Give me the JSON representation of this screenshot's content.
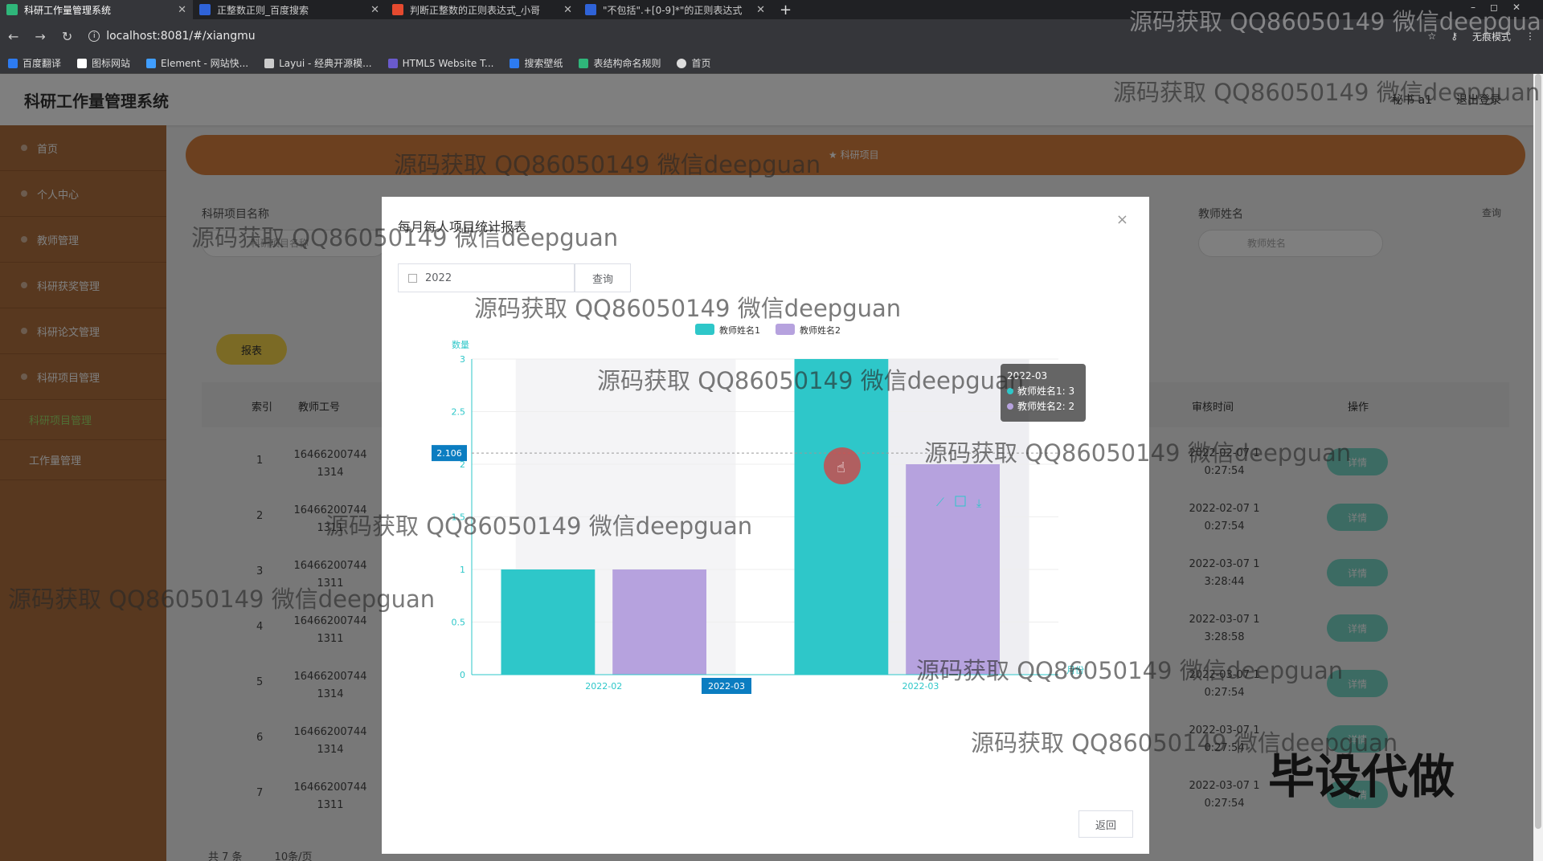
{
  "browser": {
    "tabs": [
      {
        "title": "科研工作量管理系统",
        "color": "#2fb67a",
        "active": true
      },
      {
        "title": "正整数正则_百度搜索",
        "color": "#2f63d8",
        "active": false
      },
      {
        "title": "判断正整数的正则表达式_小哥",
        "color": "#e54a2f",
        "active": false
      },
      {
        "title": "\"不包括\".+[0-9]*\"的正则表达式",
        "color": "#2f63d8",
        "active": false
      }
    ],
    "new_tab": "+",
    "url": "localhost:8081/#/xiangmu",
    "incognito_label": "无痕模式",
    "bookmarks": [
      {
        "label": "百度翻译",
        "color": "#2d7bf0"
      },
      {
        "label": "图标网站",
        "color": "#fff"
      },
      {
        "label": "Element - 网站快...",
        "color": "#409eff"
      },
      {
        "label": "Layui - 经典开源模...",
        "color": "#ccc"
      },
      {
        "label": "HTML5 Website T...",
        "color": "#6a5acd"
      },
      {
        "label": "搜索壁纸",
        "color": "#2d7bf0"
      },
      {
        "label": "表结构命名规则",
        "color": "#2fb67a"
      },
      {
        "label": "首页",
        "color": "#ddd"
      }
    ]
  },
  "app": {
    "title": "科研工作量管理系统",
    "user": "秘书 a1",
    "logout": "退出登录"
  },
  "sidebar": {
    "items": [
      {
        "label": "首页"
      },
      {
        "label": "个人中心"
      },
      {
        "label": "教师管理"
      },
      {
        "label": "科研获奖管理"
      },
      {
        "label": "科研论文管理"
      },
      {
        "label": "科研项目管理"
      },
      {
        "label": "科研项目管理"
      },
      {
        "label": "工作量管理"
      }
    ]
  },
  "main": {
    "banner_star": "★",
    "banner_text": "科研项目",
    "search_label_left": "科研项目名称",
    "search_placeholder_left": "科研项目名称",
    "search_label_right": "教师姓名",
    "search_placeholder_right": "教师姓名",
    "search_btn": "查询",
    "report_btn": "报表",
    "columns": [
      "索引",
      "教师工号",
      "审核时间",
      "操作"
    ],
    "rows": [
      {
        "idx": "1",
        "emp": "16466200744 1314",
        "time": "2022-02-07 1 0:27:54"
      },
      {
        "idx": "2",
        "emp": "16466200744 1311",
        "time": "2022-02-07 1 0:27:54"
      },
      {
        "idx": "3",
        "emp": "16466200744 1311",
        "time": "2022-03-07 1 3:28:44"
      },
      {
        "idx": "4",
        "emp": "16466200744 1311",
        "time": "2022-03-07 1 3:28:58"
      },
      {
        "idx": "5",
        "emp": "16466200744 1314",
        "time": "2022-03-07 1 0:27:54"
      },
      {
        "idx": "6",
        "emp": "16466200744 1314",
        "time": "2022-03-07 1 0:27:54"
      },
      {
        "idx": "7",
        "emp": "16466200744 1311",
        "time": "2022-03-07 1 0:27:54"
      }
    ],
    "detail_btn": "详情",
    "total": "共 7 条",
    "page_size": "10条/页"
  },
  "modal": {
    "title": "每月每人项目统计报表",
    "date_value": "2022",
    "query_btn": "查询",
    "back_btn": "返回",
    "close": "×"
  },
  "chart_data": {
    "type": "bar",
    "categories": [
      "2022-02",
      "2022-03"
    ],
    "series": [
      {
        "name": "教师姓名1",
        "values": [
          1,
          3
        ],
        "color": "#2ec7c9"
      },
      {
        "name": "教师姓名2",
        "values": [
          1,
          2
        ],
        "color": "#b6a2de"
      }
    ],
    "ylabel": "数量",
    "xlabel": "月份",
    "ylim": [
      0,
      3
    ],
    "yticks": [
      "0",
      "0.5",
      "1",
      "1.5",
      "2",
      "2.5",
      "3"
    ],
    "pointer_label_y": "2.106",
    "pointer_label_x": "2022-03",
    "legend_position": "top-center",
    "tooltip": {
      "title": "2022-03",
      "lines": [
        "教师姓名1: 3",
        "教师姓名2: 2"
      ]
    }
  },
  "overlay_text": {
    "watermark": "源码获取 QQ86050149 微信deepguan",
    "stamp": "毕设代做"
  }
}
